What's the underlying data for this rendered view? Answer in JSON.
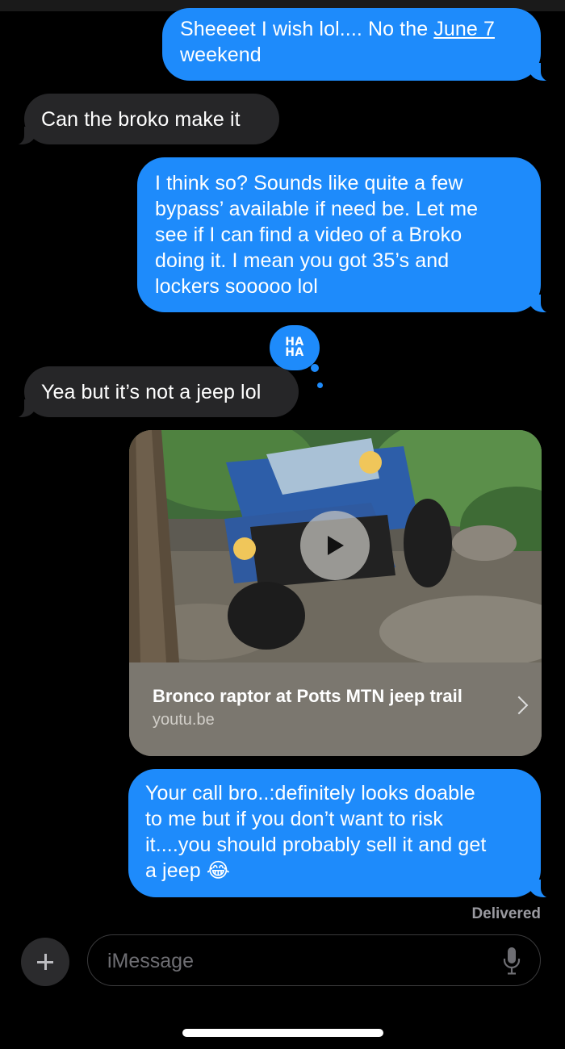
{
  "messages": [
    {
      "id": "m1",
      "direction": "sent",
      "text_before": "Sheeeet I wish lol.... No the ",
      "link": "June 7",
      "text_after": "\nweekend"
    },
    {
      "id": "m2",
      "direction": "received",
      "text": "Can the broko make it"
    },
    {
      "id": "m3",
      "direction": "sent",
      "text": "I think so?   Sounds like quite a few\nbypass’ available if need be.   Let me\nsee if I can find a video of a Broko\ndoing it.   I mean you got 35’s and\nlockers sooooo lol"
    },
    {
      "id": "m4",
      "direction": "received",
      "text": "Yea but it’s not a jeep lol",
      "tapback": {
        "line1": "HA",
        "line2": "HA",
        "icon": "haha-tapback-icon"
      }
    },
    {
      "id": "m5",
      "direction": "sent",
      "text": "Your call bro..:definitely looks doable\nto me but if you don’t want to risk\nit....you should probably sell it and get\na jeep 😂"
    }
  ],
  "link_preview": {
    "title": "Bronco raptor at Potts MTN jeep trail",
    "domain": "youtu.be",
    "icon": "play-icon"
  },
  "status": "Delivered",
  "composer": {
    "placeholder": "iMessage",
    "left_icon": "plus-icon",
    "right_icon": "mic-icon"
  },
  "colors": {
    "sent_bubble": "#1e8bfb",
    "received_bubble": "#262628",
    "background": "#000000",
    "card_footer": "#7b776f"
  }
}
